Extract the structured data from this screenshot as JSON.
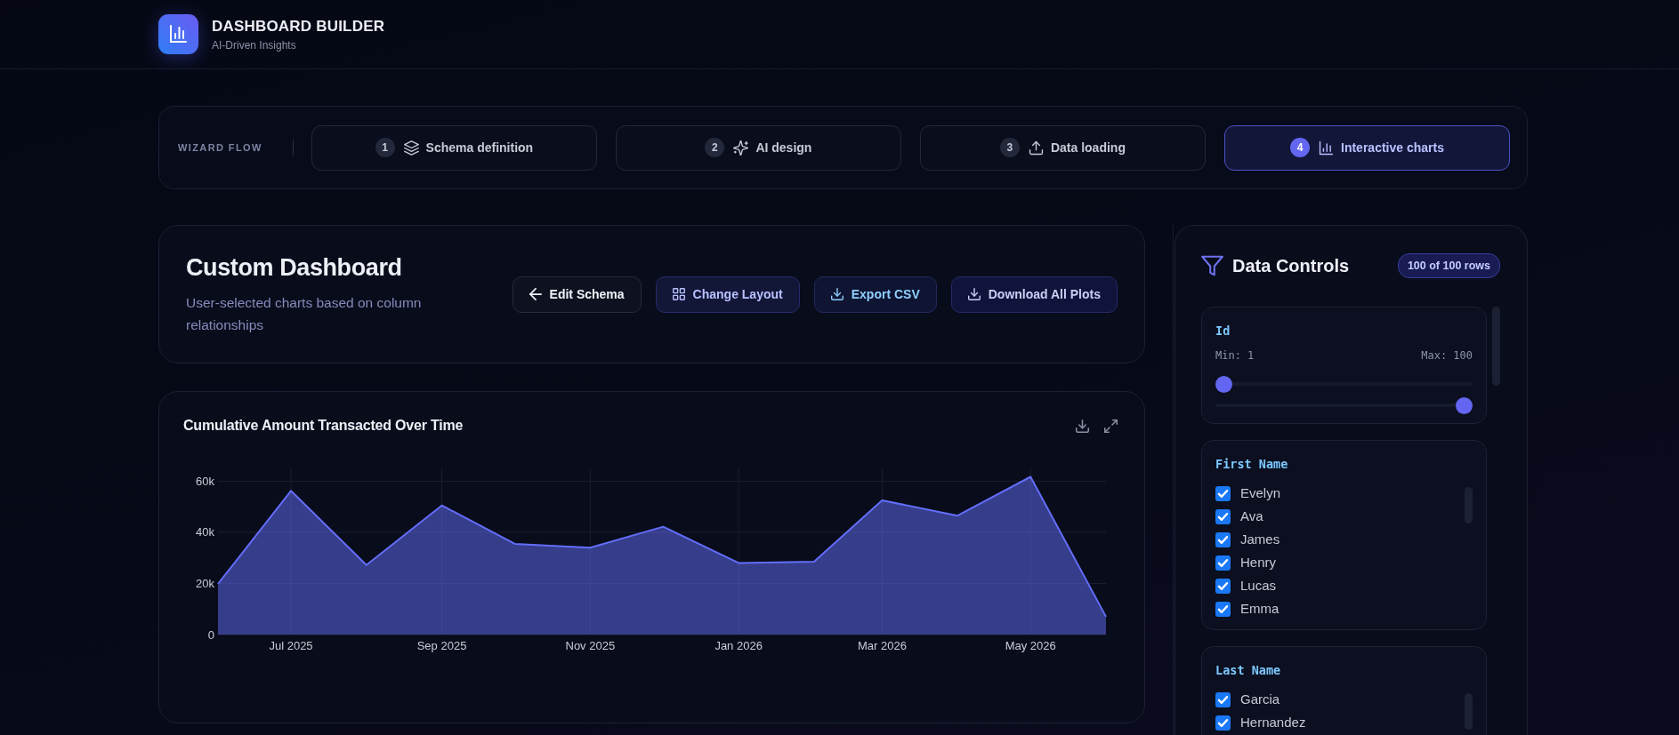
{
  "header": {
    "title": "DASHBOARD BUILDER",
    "subtitle": "AI-Driven Insights"
  },
  "wizard": {
    "label": "WIZARD FLOW",
    "steps": [
      {
        "number": "1",
        "label": "Schema definition",
        "kind": "schema",
        "selected": false
      },
      {
        "number": "2",
        "label": "AI design",
        "kind": "design",
        "selected": false
      },
      {
        "number": "3",
        "label": "Data loading",
        "kind": "load",
        "selected": false
      },
      {
        "number": "4",
        "label": "Interactive charts",
        "kind": "charts",
        "selected": true
      }
    ]
  },
  "dashboard": {
    "title": "Custom Dashboard",
    "subtitle": "User-selected charts based on column relationships",
    "actions": [
      {
        "label": "Edit Schema",
        "kind": "back"
      },
      {
        "label": "Change Layout",
        "kind": "layout"
      },
      {
        "label": "Export CSV",
        "kind": "export"
      },
      {
        "label": "Download All Plots",
        "kind": "download"
      }
    ]
  },
  "chart_card": {
    "chart_data": {
      "type": "area",
      "title": "Cumulative Amount Transacted Over Time",
      "x": [
        "2025-06-01",
        "2025-07-01",
        "2025-08-01",
        "2025-09-01",
        "2025-10-01",
        "2025-11-01",
        "2025-12-01",
        "2026-01-01",
        "2026-02-01",
        "2026-03-01",
        "2026-04-01",
        "2026-05-01",
        "2026-06-01"
      ],
      "series": [
        {
          "color": "#636efa",
          "values": [
            19800,
            56200,
            27200,
            50500,
            35500,
            34000,
            42200,
            28000,
            28500,
            52500,
            46500,
            61700,
            7000
          ]
        }
      ],
      "xlim": [
        "2025-06-01",
        "2026-06-01"
      ],
      "ylim": [
        0,
        65000
      ],
      "grid": true,
      "xticks": [
        {
          "value": "2025-07-01",
          "label": "Jul 2025"
        },
        {
          "value": "2025-09-01",
          "label": "Sep 2025"
        },
        {
          "value": "2025-11-01",
          "label": "Nov 2025"
        },
        {
          "value": "2026-01-01",
          "label": "Jan 2026"
        },
        {
          "value": "2026-03-01",
          "label": "Mar 2026"
        },
        {
          "value": "2026-05-01",
          "label": "May 2026"
        }
      ],
      "yticks": [
        {
          "value": 0,
          "label": "0"
        },
        {
          "value": 20000,
          "label": "20k"
        },
        {
          "value": 40000,
          "label": "40k"
        },
        {
          "value": 60000,
          "label": "60k"
        }
      ]
    }
  },
  "data_controls": {
    "title": "Data Controls",
    "row_count": "100 of 100 rows",
    "filters": [
      {
        "kind": "range",
        "column": "Id",
        "min_label": "Min: 1",
        "max_label": "Max: 100",
        "sliders": [
          {
            "level": 0
          },
          {
            "level": 1
          }
        ]
      },
      {
        "kind": "checklist",
        "column": "First Name",
        "options": [
          {
            "label": "Evelyn",
            "checked": true
          },
          {
            "label": "Ava",
            "checked": true
          },
          {
            "label": "James",
            "checked": true
          },
          {
            "label": "Henry",
            "checked": true
          },
          {
            "label": "Lucas",
            "checked": true
          },
          {
            "label": "Emma",
            "checked": true
          }
        ]
      },
      {
        "kind": "checklist",
        "column": "Last Name",
        "options": [
          {
            "label": "Garcia",
            "checked": true
          },
          {
            "label": "Hernandez",
            "checked": true
          }
        ]
      }
    ]
  }
}
